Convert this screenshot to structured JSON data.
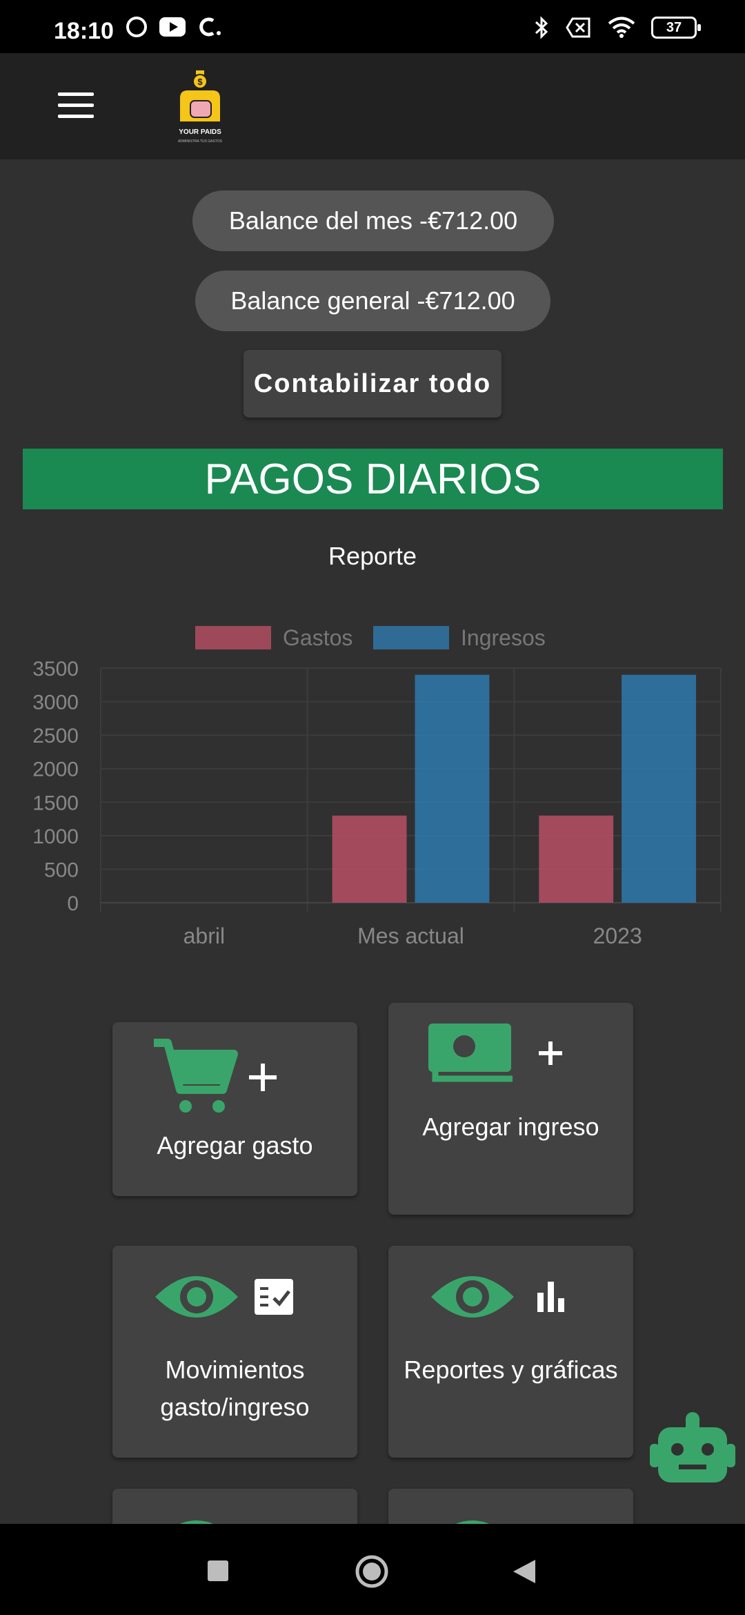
{
  "status": {
    "time": "18:10",
    "battery": "37"
  },
  "logo": {
    "text": "YOUR PAIDS",
    "subtext": "ADMINISTRA TUS GASTOS"
  },
  "balances": {
    "month": "Balance del mes -€712.00",
    "general": "Balance general -€712.00"
  },
  "count_all_button": "Contabilizar todo",
  "banner": "PAGOS DIARIOS",
  "report_title": "Reporte",
  "colors": {
    "expenses": "#b04e62",
    "income": "#2f75a6",
    "accent_green": "#3aa56a",
    "banner": "#1a8a52"
  },
  "chart_data": {
    "type": "bar",
    "categories": [
      "abril",
      "Mes actual",
      "2023"
    ],
    "series": [
      {
        "name": "Gastos",
        "values": [
          0,
          1300,
          1300
        ]
      },
      {
        "name": "Ingresos",
        "values": [
          0,
          3400,
          3400
        ]
      }
    ],
    "ylim": [
      0,
      3500
    ],
    "yticks": [
      "3500",
      "3000",
      "2500",
      "2000",
      "1500",
      "1000",
      "500",
      "0"
    ],
    "grid": true,
    "legend": "top"
  },
  "cards": {
    "add_expense": "Agregar gasto",
    "add_income": "Agregar ingreso",
    "movements": "Movimientos gasto/ingreso",
    "reports": "Reportes y gráficas"
  }
}
